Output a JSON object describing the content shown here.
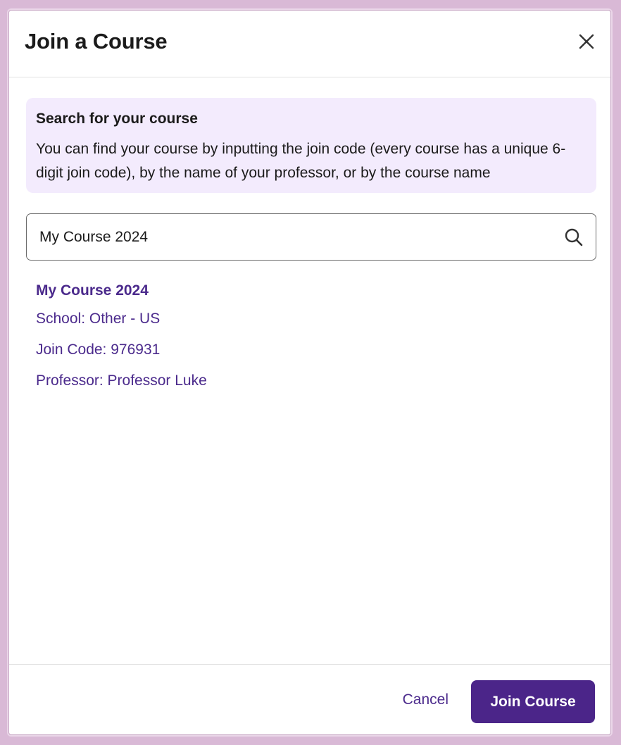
{
  "dialog": {
    "title": "Join a Course",
    "close_icon": "close-icon"
  },
  "info": {
    "title": "Search for your course",
    "text": "You can find your course by inputting the join code (every course has a unique 6-digit join code), by the name of your professor, or by the course name"
  },
  "search": {
    "value": "My Course 2024",
    "icon": "search-icon"
  },
  "result": {
    "name": "My Course 2024",
    "school": "School: Other - US",
    "join_code": "Join Code: 976931",
    "professor": "Professor: Professor Luke"
  },
  "footer": {
    "cancel_label": "Cancel",
    "join_label": "Join Course"
  },
  "colors": {
    "accent": "#4b2589",
    "info_bg": "#f3ebfd",
    "link": "#4b2a8c"
  }
}
